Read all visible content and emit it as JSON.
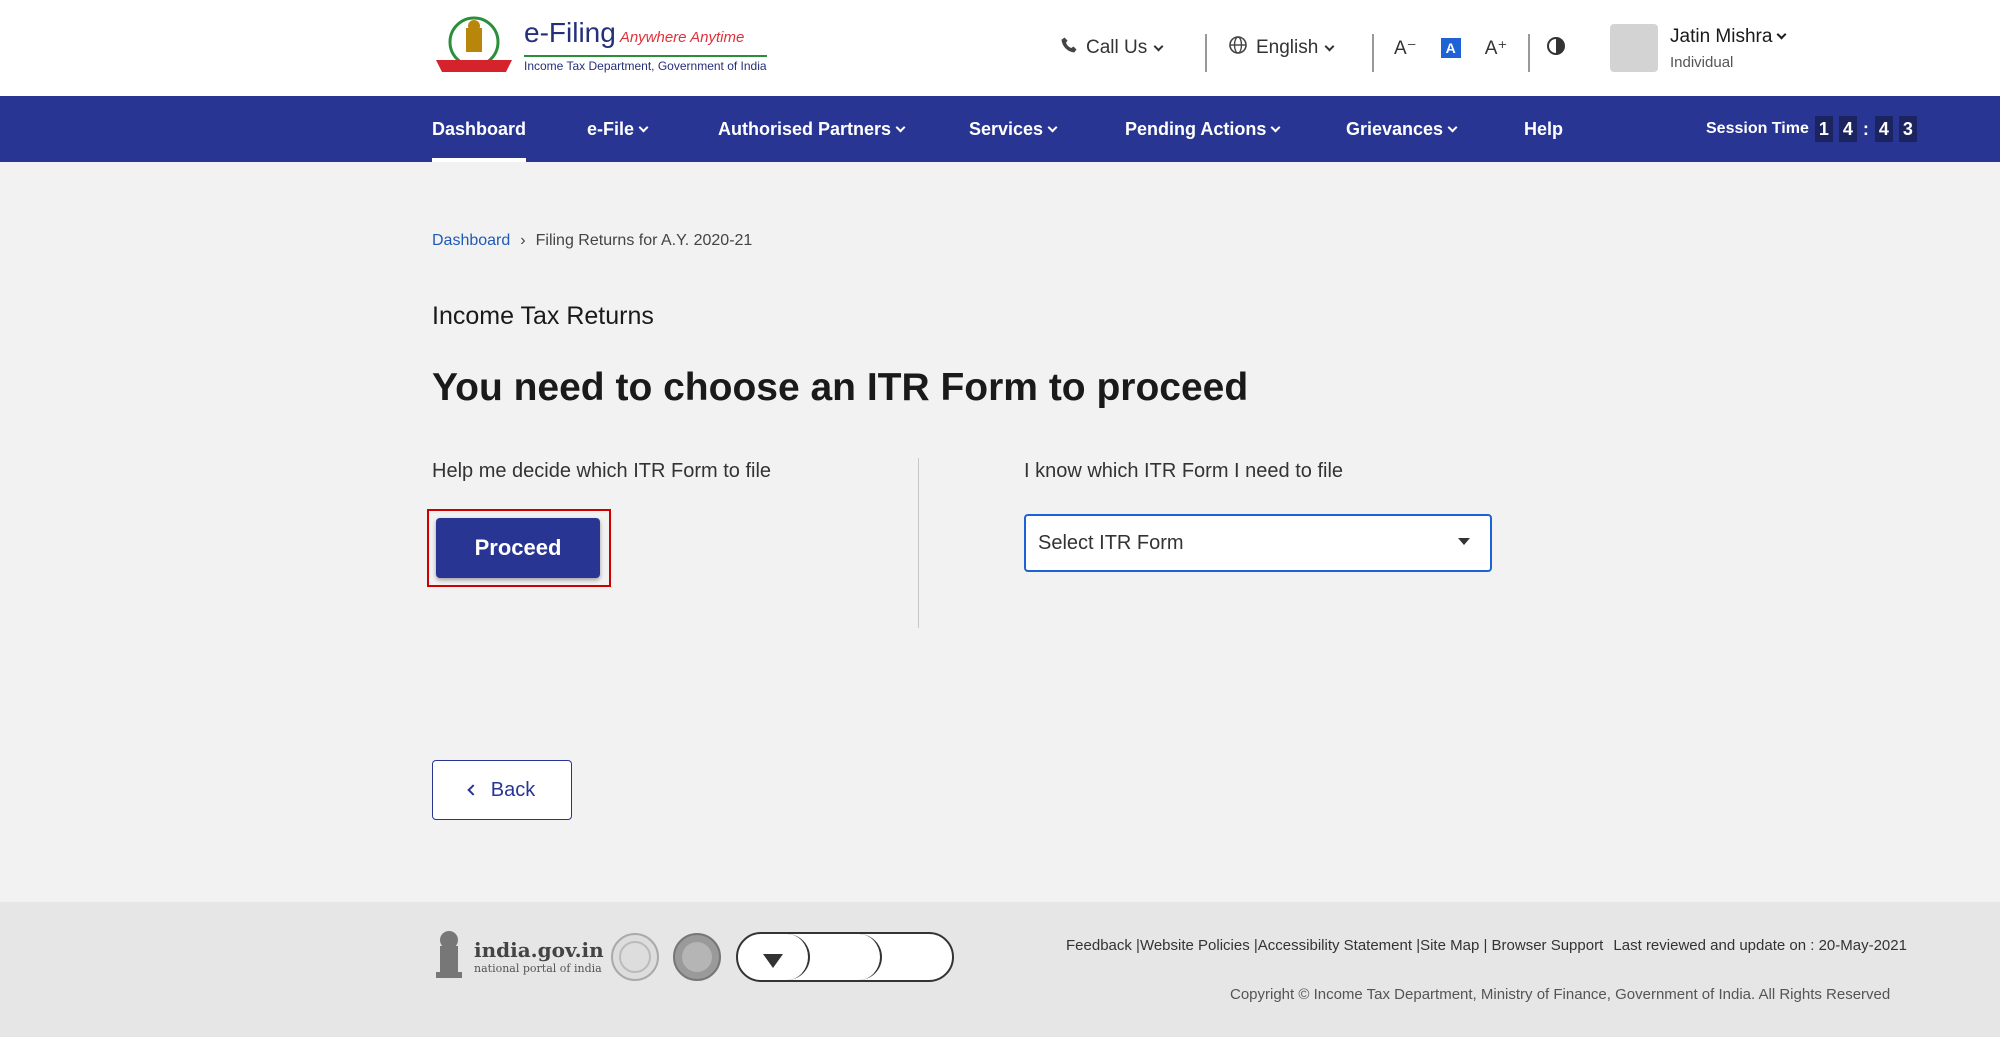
{
  "header": {
    "logo_title": "e-Filing",
    "logo_tagline": "Anywhere Anytime",
    "logo_subtitle": "Income Tax Department, Government of India",
    "call_us": "Call Us",
    "language": "English",
    "font_decrease": "A⁻",
    "font_normal": "A",
    "font_increase": "A⁺",
    "user_name": "Jatin Mishra",
    "user_role": "Individual"
  },
  "nav": {
    "items": [
      {
        "label": "Dashboard"
      },
      {
        "label": "e-File"
      },
      {
        "label": "Authorised Partners"
      },
      {
        "label": "Services"
      },
      {
        "label": "Pending Actions"
      },
      {
        "label": "Grievances"
      },
      {
        "label": "Help"
      }
    ],
    "session_label": "Session Time",
    "session_digits": [
      "1",
      "4",
      "4",
      "3"
    ]
  },
  "breadcrumb": {
    "root": "Dashboard",
    "separator": "›",
    "current": "Filing Returns for A.Y. 2020-21"
  },
  "main": {
    "section_title": "Income Tax Returns",
    "heading": "You need to choose an ITR Form to proceed",
    "left_label": "Help me decide which ITR Form to file",
    "proceed_label": "Proceed",
    "right_label": "I know which ITR Form I need to file",
    "select_value": "Select ITR Form",
    "back_label": "Back"
  },
  "footer": {
    "indiagov_title": "india.gov.in",
    "indiagov_sub": "national portal of india",
    "links": [
      "Feedback |",
      "Website Policies |",
      "Accessibility Statement |",
      "Site Map |",
      "Browser Support"
    ],
    "last_reviewed": "Last reviewed and update on : 20-May-2021",
    "copyright": "Copyright © Income Tax Department, Ministry of Finance, Government of India. All Rights Reserved"
  },
  "colors": {
    "nav_blue": "#283593",
    "link_blue": "#1e5bb8",
    "highlight_red": "#cc0000"
  }
}
